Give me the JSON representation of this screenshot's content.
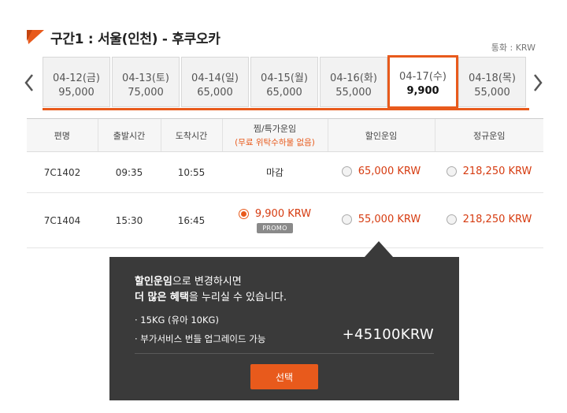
{
  "header": {
    "title": "구간1 :  서울(인천) - 후쿠오카",
    "currency": "통화 : KRW",
    "accent": "#e85a1c"
  },
  "dates": [
    {
      "date": "04-12(금)",
      "price": "95,000",
      "active": false
    },
    {
      "date": "04-13(토)",
      "price": "75,000",
      "active": false
    },
    {
      "date": "04-14(일)",
      "price": "65,000",
      "active": false
    },
    {
      "date": "04-15(월)",
      "price": "65,000",
      "active": false
    },
    {
      "date": "04-16(화)",
      "price": "55,000",
      "active": false
    },
    {
      "date": "04-17(수)",
      "price": "9,900",
      "active": true
    },
    {
      "date": "04-18(목)",
      "price": "55,000",
      "active": false
    }
  ],
  "table": {
    "headers": {
      "flight": "편명",
      "departure": "출발시간",
      "arrival": "도착시간",
      "special": "찜/특가운임",
      "special_sub": "(무료 위탁수하물 없음)",
      "discount": "할인운임",
      "regular": "정규운임"
    },
    "rows": [
      {
        "flight": "7C1402",
        "departure": "09:35",
        "arrival": "10:55",
        "special": "마감",
        "discount": "65,000 KRW",
        "regular": "218,250 KRW"
      },
      {
        "flight": "7C1404",
        "departure": "15:30",
        "arrival": "16:45",
        "special": "9,900 KRW",
        "promo": "PROMO",
        "discount": "55,000 KRW",
        "regular": "218,250 KRW"
      }
    ]
  },
  "popup": {
    "line1_bold": "할인운임",
    "line1_rest": "으로 변경하시면",
    "line2_bold": "더 많은 혜택",
    "line2_rest": "을 누리실 수 있습니다.",
    "bullet1": "· 15KG (유아 10KG)",
    "bullet2": "· 부가서비스 번들 업그레이드 가능",
    "extra": "+45100KRW",
    "button": "선택"
  },
  "icons": {
    "prev": "chevron-left-icon",
    "next": "chevron-right-icon",
    "flag": "flag-icon"
  }
}
